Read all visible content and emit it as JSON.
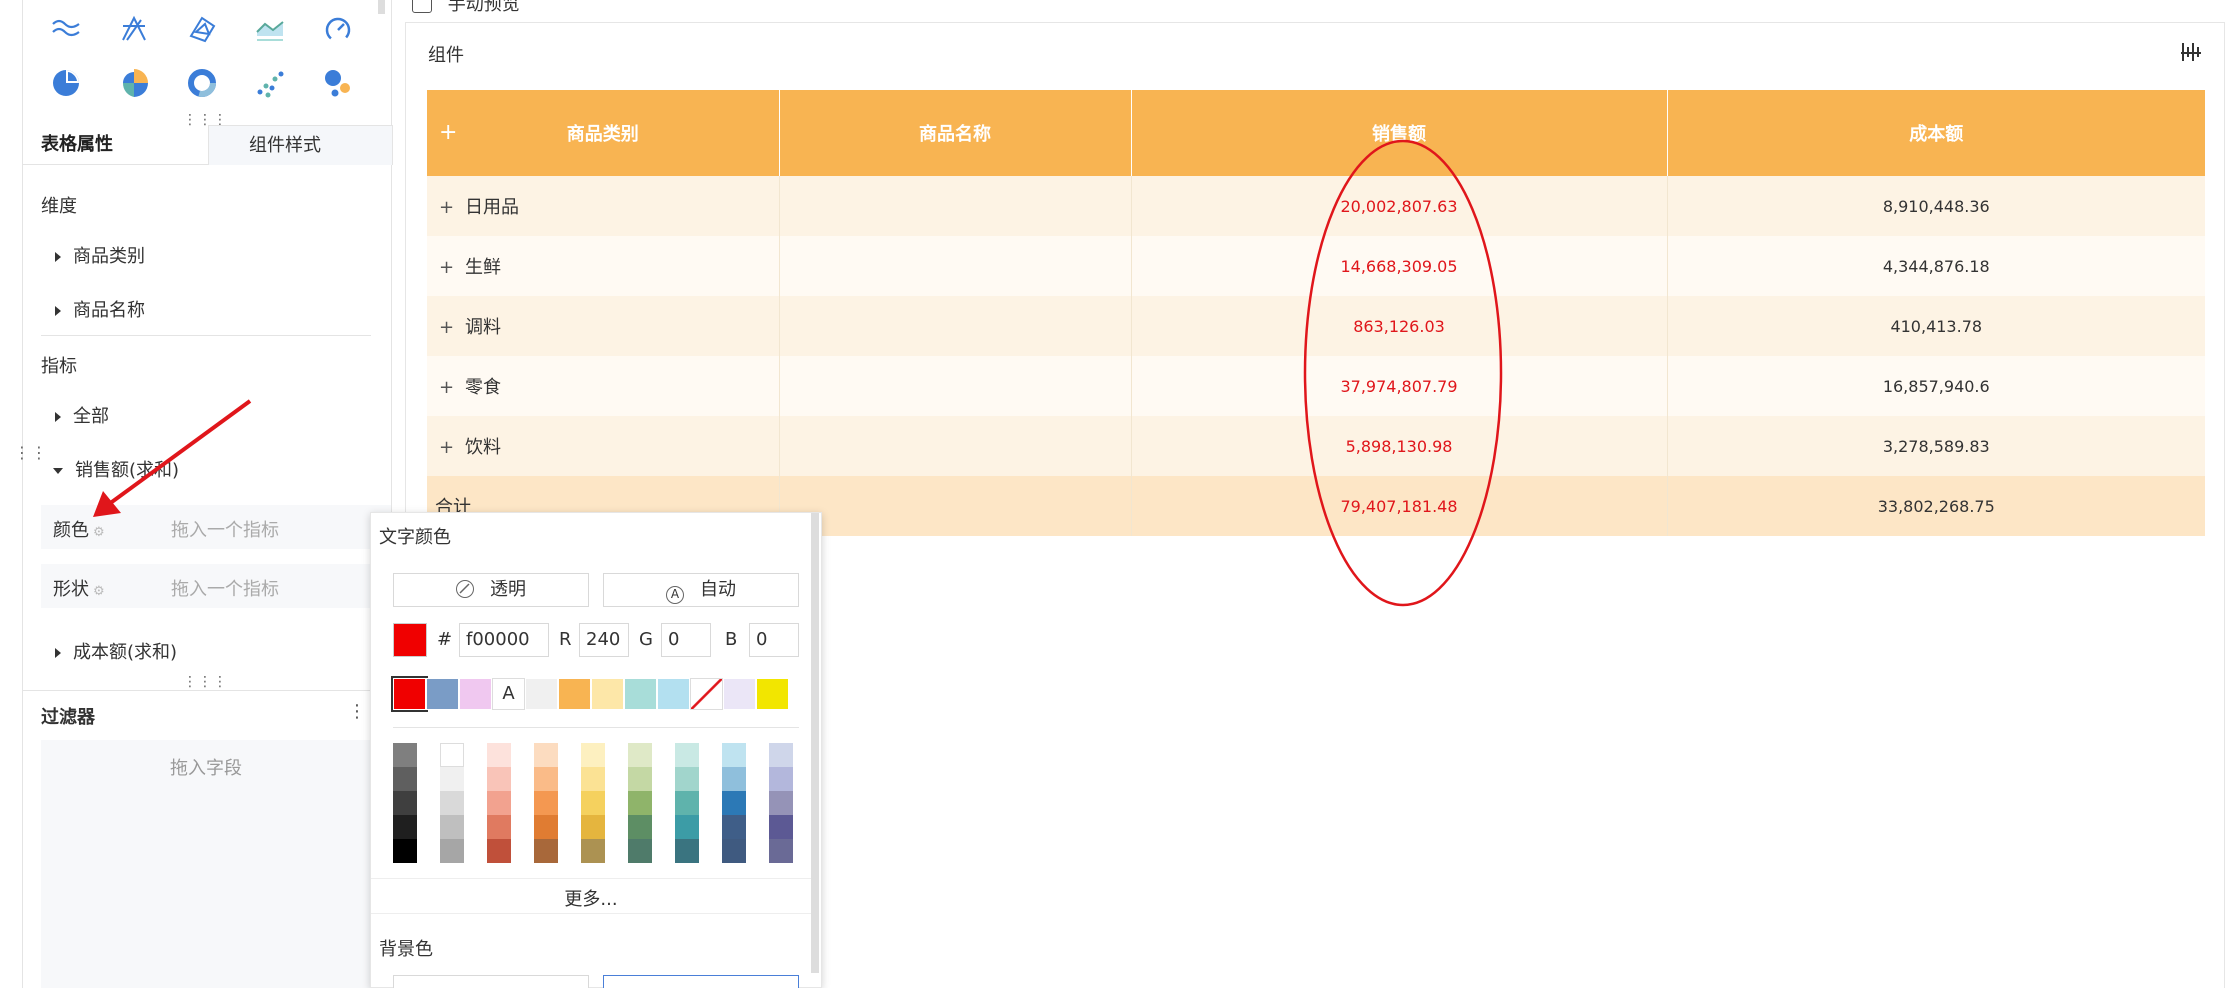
{
  "checkbox": {
    "label": "手动预览"
  },
  "chart_icons": {
    "row1": [
      "wave-icon",
      "radar-icon",
      "polar-icon",
      "area-chart-icon",
      "gauge-icon"
    ],
    "row2": [
      "pie-icon",
      "rose-pie-icon",
      "donut-icon",
      "scatter-icon",
      "bubble-icon"
    ]
  },
  "tabs": {
    "table_props": "表格属性",
    "component_style": "组件样式"
  },
  "dimensions": {
    "title": "维度",
    "items": [
      "商品类别",
      "商品名称"
    ]
  },
  "metrics": {
    "title": "指标",
    "items": [
      "全部",
      "销售额(求和)",
      "成本额(求和)"
    ],
    "color_label": "颜色",
    "shape_label": "形状",
    "drop_placeholder": "拖入一个指标"
  },
  "filter": {
    "title": "过滤器",
    "placeholder": "拖入字段"
  },
  "component": {
    "title": "组件"
  },
  "table": {
    "headers": [
      "商品类别",
      "商品名称",
      "销售额",
      "成本额"
    ],
    "rows": [
      {
        "category": "日用品",
        "sales": "20,002,807.63",
        "cost": "8,910,448.36"
      },
      {
        "category": "生鲜",
        "sales": "14,668,309.05",
        "cost": "4,344,876.18"
      },
      {
        "category": "调料",
        "sales": "863,126.03",
        "cost": "410,413.78"
      },
      {
        "category": "零食",
        "sales": "37,974,807.79",
        "cost": "16,857,940.6"
      },
      {
        "category": "饮料",
        "sales": "5,898,130.98",
        "cost": "3,278,589.83"
      }
    ],
    "total": {
      "label": "合计",
      "sales": "79,407,181.48",
      "cost": "33,802,268.75"
    }
  },
  "color_picker": {
    "text_color_title": "文字颜色",
    "transparent": "透明",
    "auto": "自动",
    "hash": "#",
    "hex": "f00000",
    "r_label": "R",
    "r": "240",
    "g_label": "G",
    "g": "0",
    "b_label": "B",
    "b": "0",
    "swatch_text": "A",
    "recent": [
      "#f00000",
      "#7a9cc6",
      "#f0c8f0",
      "A",
      "#f0f0f0",
      "#f8b452",
      "#fde7a8",
      "#a8ddd9",
      "#b3e0f0",
      "none",
      "#ebe6f7",
      "#f2e600"
    ],
    "palette": [
      [
        "#7f7f7f",
        "#5f5f5f",
        "#3f3f3f",
        "#1f1f1f",
        "#000000"
      ],
      [
        "#ffffff",
        "#f0f0f0",
        "#d9d9d9",
        "#bfbfbf",
        "#a6a6a6"
      ],
      [
        "#fde2dc",
        "#f9c4b8",
        "#f2a28f",
        "#e07a60",
        "#c0503a"
      ],
      [
        "#fcdcc0",
        "#fabb88",
        "#f49851",
        "#e07c32",
        "#a8683a"
      ],
      [
        "#fdf0c0",
        "#fbe294",
        "#f5d15e",
        "#e5b53e",
        "#ac9252"
      ],
      [
        "#dfe9c7",
        "#c4d8a4",
        "#8fb46a",
        "#5d8e64",
        "#4f7b6a"
      ],
      [
        "#c9e9e4",
        "#a1d5cc",
        "#5fb3ac",
        "#3c9ca6",
        "#3a7480"
      ],
      [
        "#bfe3f0",
        "#8fbfdc",
        "#2c79b6",
        "#3f5e88",
        "#3f5a80"
      ],
      [
        "#cfd6ea",
        "#b3b7dc",
        "#9593b7",
        "#5c5994",
        "#6a6a96"
      ]
    ],
    "more": "更多...",
    "bg_color_title": "背景色"
  },
  "colors": {
    "accent": "#f8b452",
    "highlight": "#e0161b",
    "annotation": "#e0161b"
  }
}
